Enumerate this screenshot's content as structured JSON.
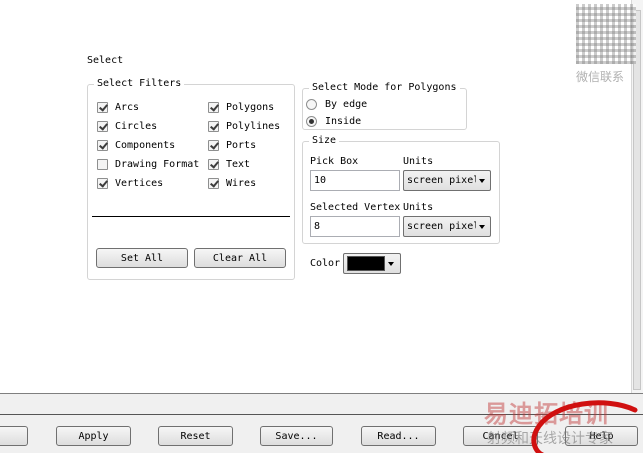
{
  "dialog": {
    "title": "Select"
  },
  "filters": {
    "legend": "Select Filters",
    "left": [
      {
        "label": "Arcs",
        "checked": true
      },
      {
        "label": "Circles",
        "checked": true
      },
      {
        "label": "Components",
        "checked": true
      },
      {
        "label": "Drawing Format",
        "checked": false
      },
      {
        "label": "Vertices",
        "checked": true
      }
    ],
    "right": [
      {
        "label": "Polygons",
        "checked": true
      },
      {
        "label": "Polylines",
        "checked": true
      },
      {
        "label": "Ports",
        "checked": true
      },
      {
        "label": "Text",
        "checked": true
      },
      {
        "label": "Wires",
        "checked": true
      }
    ],
    "set_all": "Set All",
    "clear_all": "Clear All"
  },
  "mode": {
    "legend": "Select Mode for Polygons",
    "options": [
      {
        "label": "By edge",
        "selected": false
      },
      {
        "label": "Inside",
        "selected": true
      }
    ]
  },
  "size": {
    "legend": "Size",
    "pick_box_label": "Pick Box",
    "pick_box_value": "10",
    "units_label_1": "Units",
    "units_value_1": "screen pixels",
    "selected_vertex_label": "Selected Vertex",
    "selected_vertex_value": "8",
    "units_label_2": "Units",
    "units_value_2": "screen pixels"
  },
  "color": {
    "label": "Color",
    "value": "#000000"
  },
  "buttons": {
    "apply": "Apply",
    "reset": "Reset",
    "save": "Save...",
    "read": "Read...",
    "cancel": "Cancel",
    "help": "Help"
  },
  "watermark": {
    "brand": "易迪拓培训",
    "tagline": "射频和天线设计专家",
    "qr_caption": "微信联系"
  }
}
